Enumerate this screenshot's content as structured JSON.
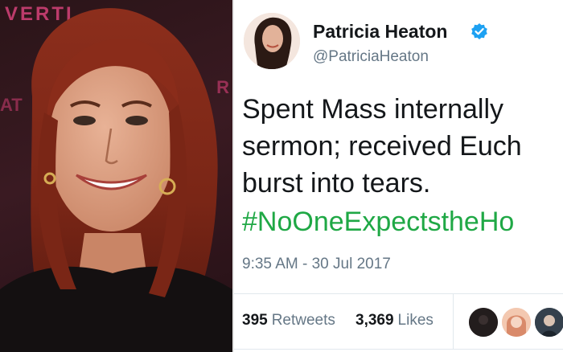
{
  "photo": {
    "backdrop_text": "VERTI",
    "backdrop_fragment_right": "R",
    "backdrop_fragment_left": "AT"
  },
  "tweet": {
    "author_name": "Patricia Heaton",
    "handle": "@PatriciaHeaton",
    "text_lines": [
      "Spent Mass internally",
      "sermon; received Euch",
      "burst into tears."
    ],
    "hashtag": "#NoOneExpectstheHo",
    "timestamp": "9:35 AM - 30 Jul 2017",
    "retweets": {
      "count": "395",
      "label": "Retweets"
    },
    "likes": {
      "count": "3,369",
      "label": "Likes"
    },
    "colors": {
      "hashtag": "#1fa845",
      "verified": "#1da1f2",
      "muted": "#657786",
      "text": "#14171a"
    },
    "verified_icon": "verified-badge-icon"
  }
}
